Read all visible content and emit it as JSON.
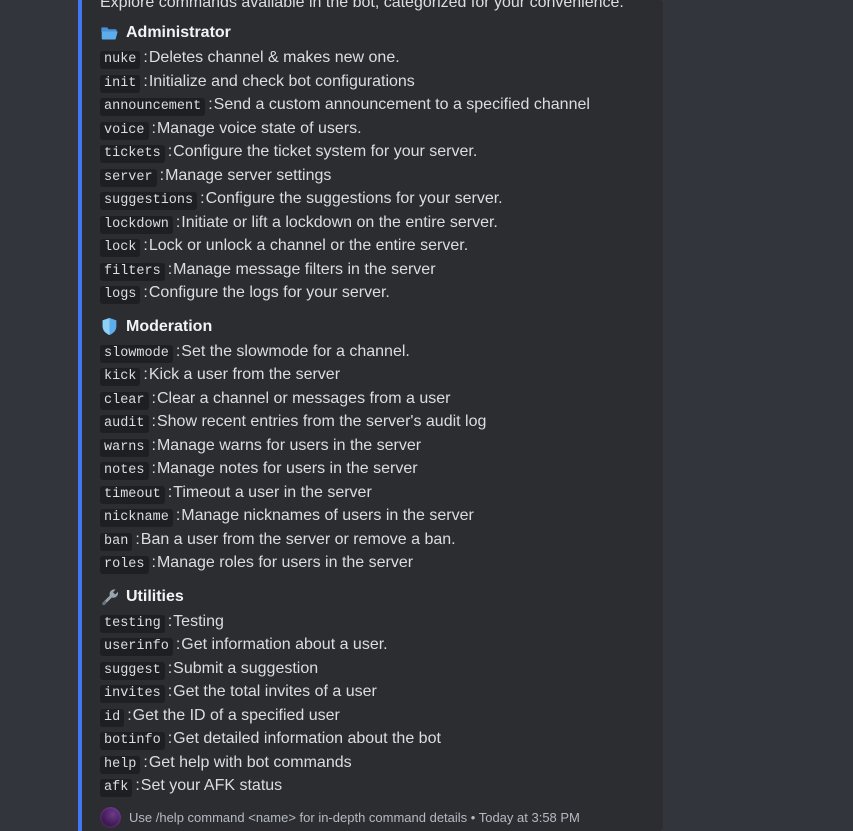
{
  "theme": {
    "chat_background": "#32353b",
    "embed_background": "#2b2d31",
    "embed_accent_color": "#4376f5",
    "code_chip_background": "#1e1f22",
    "text_color": "#dbdee1",
    "footer_text_color": "#b5bac1"
  },
  "embed": {
    "description": "Explore commands available in the bot, categorized for your convenience.",
    "sections": [
      {
        "emoji": "open-folder-emoji",
        "title": "Administrator",
        "commands": [
          {
            "name": "nuke",
            "separator": ":",
            "description": "Deletes channel & makes new one."
          },
          {
            "name": "init",
            "separator": ":",
            "description": "Initialize and check bot configurations"
          },
          {
            "name": "announcement",
            "separator": ":",
            "description": "Send a custom announcement to a specified channel"
          },
          {
            "name": "voice",
            "separator": ":",
            "description": "Manage voice state of users."
          },
          {
            "name": "tickets",
            "separator": ":",
            "description": "Configure the ticket system for your server."
          },
          {
            "name": "server",
            "separator": ":",
            "description": "Manage server settings"
          },
          {
            "name": "suggestions",
            "separator": ":",
            "description": "Configure the suggestions for your server."
          },
          {
            "name": "lockdown",
            "separator": ":",
            "description": "Initiate or lift a lockdown on the entire server."
          },
          {
            "name": "lock",
            "separator": ":",
            "description": "Lock or unlock a channel or the entire server."
          },
          {
            "name": "filters",
            "separator": ":",
            "description": "Manage message filters in the server"
          },
          {
            "name": "logs",
            "separator": ":",
            "description": "Configure the logs for your server."
          }
        ]
      },
      {
        "emoji": "shield-emoji",
        "title": "Moderation",
        "commands": [
          {
            "name": "slowmode",
            "separator": ":",
            "description": "Set the slowmode for a channel."
          },
          {
            "name": "kick",
            "separator": ":",
            "description": "Kick a user from the server"
          },
          {
            "name": "clear",
            "separator": ":",
            "description": "Clear a channel or messages from a user"
          },
          {
            "name": "audit",
            "separator": ":",
            "description": "Show recent entries from the server's audit log"
          },
          {
            "name": "warns",
            "separator": ":",
            "description": "Manage warns for users in the server"
          },
          {
            "name": "notes",
            "separator": ":",
            "description": "Manage notes for users in the server"
          },
          {
            "name": "timeout",
            "separator": ":",
            "description": "Timeout a user in the server"
          },
          {
            "name": "nickname",
            "separator": ":",
            "description": "Manage nicknames of users in the server"
          },
          {
            "name": "ban",
            "separator": ":",
            "description": "Ban a user from the server or remove a ban."
          },
          {
            "name": "roles",
            "separator": ":",
            "description": "Manage roles for users in the server"
          }
        ]
      },
      {
        "emoji": "wrench-emoji",
        "title": "Utilities",
        "commands": [
          {
            "name": "testing",
            "separator": ":",
            "description": "Testing"
          },
          {
            "name": "userinfo",
            "separator": ":",
            "description": "Get information about a user."
          },
          {
            "name": "suggest",
            "separator": ":",
            "description": "Submit a suggestion"
          },
          {
            "name": "invites",
            "separator": ":",
            "description": "Get the total invites of a user"
          },
          {
            "name": "id",
            "separator": ":",
            "description": "Get the ID of a specified user"
          },
          {
            "name": "botinfo",
            "separator": ":",
            "description": "Get detailed information about the bot"
          },
          {
            "name": "help",
            "separator": ":",
            "description": "Get help with bot commands"
          },
          {
            "name": "afk",
            "separator": ":",
            "description": "Set your AFK status"
          }
        ]
      }
    ],
    "footer": {
      "avatar": "bot-avatar",
      "text": "Use /help command <name> for in-depth command details • Today at 3:58 PM"
    }
  }
}
